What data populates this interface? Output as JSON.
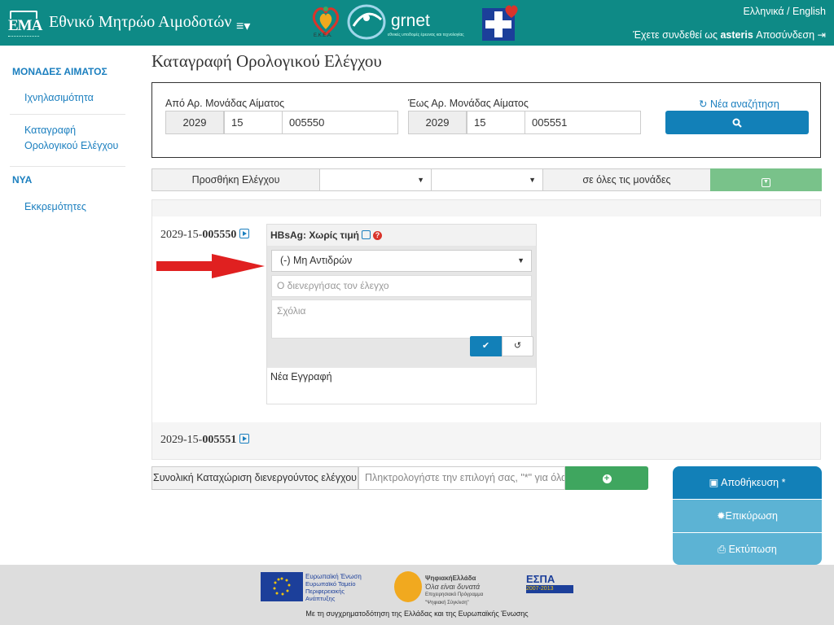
{
  "header": {
    "logo_text": "EMA",
    "app_title": "Εθνικό Μητρώο Αιμοδοτών",
    "partner_logo_1": "Ε.Κ.Ε.Α.",
    "partner_grnet": "grnet",
    "partner_grnet_sub": "εθνικές υποδομές έρευνας και τεχνολογίας",
    "language": "Ελληνικά / English",
    "logged_prefix": "Έχετε συνδεθεί ως",
    "username": "asteris",
    "logout": "Αποσύνδεση",
    "bg_color": "#0e8a86"
  },
  "sidebar": {
    "section1": "ΜΟΝΑΔΕΣ ΑΙΜΑΤΟΣ",
    "item1": "Ιχνηλασιμότητα",
    "item2_line1": "Καταγραφή",
    "item2_line2": "Ορολογικού Ελέγχου",
    "section2": "ΝΥΑ",
    "item3": "Εκκρεμότητες"
  },
  "main": {
    "page_title": "Καταγραφή Ορολογικού Ελέγχου",
    "search": {
      "from_label": "Από Αρ. Μονάδας Αίματος",
      "from_year": "2029",
      "from_center": "15",
      "from_number": "005550",
      "to_label": "Έως Αρ. Μονάδας Αίματος",
      "to_year": "2029",
      "to_center": "15",
      "to_number": "005551",
      "new_search": "Νέα αναζήτηση"
    },
    "toolbar": {
      "add_test": "Προσθήκη Ελέγχου",
      "select1": "",
      "select2": "",
      "all_units": "σε όλες τις μονάδες"
    },
    "results": [
      {
        "prefix": "2029-15-",
        "number": "005550"
      },
      {
        "prefix": "2029-15-",
        "number": "005551"
      }
    ],
    "card": {
      "title": "HBsAg: Χωρίς τιμή",
      "help": "?",
      "result_value": "(-) Μη Αντιδρών",
      "performer_placeholder": "Ο διενεργήσας τον έλεγχο",
      "comments_placeholder": "Σχόλια",
      "new_entry": "Νέα Εγγραφή"
    },
    "bulk": {
      "label": "Συνολική Καταχώριση διενεργούντος ελέγχου",
      "placeholder": "Πληκτρολογήστε την επιλογή σας, \"*\" για όλα"
    },
    "actions": {
      "save": "Αποθήκευση *",
      "verify": "Επικύρωση",
      "print": "Εκτύπωση"
    }
  },
  "footer": {
    "eu_title": "Ευρωπαϊκή Ένωση",
    "eu_line1": "Ευρωπαϊκό Ταμείο",
    "eu_line2": "Περιφερειακής",
    "eu_line3": "Ανάπτυξης",
    "digital_title": "ΨηφιακήΕλλάδα",
    "digital_sub": "Όλα είναι δυνατά",
    "digital_line1": "Επιχειρησιακό Πρόγραμμα",
    "digital_line2": "\"Ψηφιακή Σύγκλιση\"",
    "espa": "ΕΣΠΑ",
    "espa_years": "2007-2013",
    "funding_text": "Με τη συγχρηματοδότηση της Ελλάδας και της Ευρωπαϊκής Ένωσης"
  }
}
